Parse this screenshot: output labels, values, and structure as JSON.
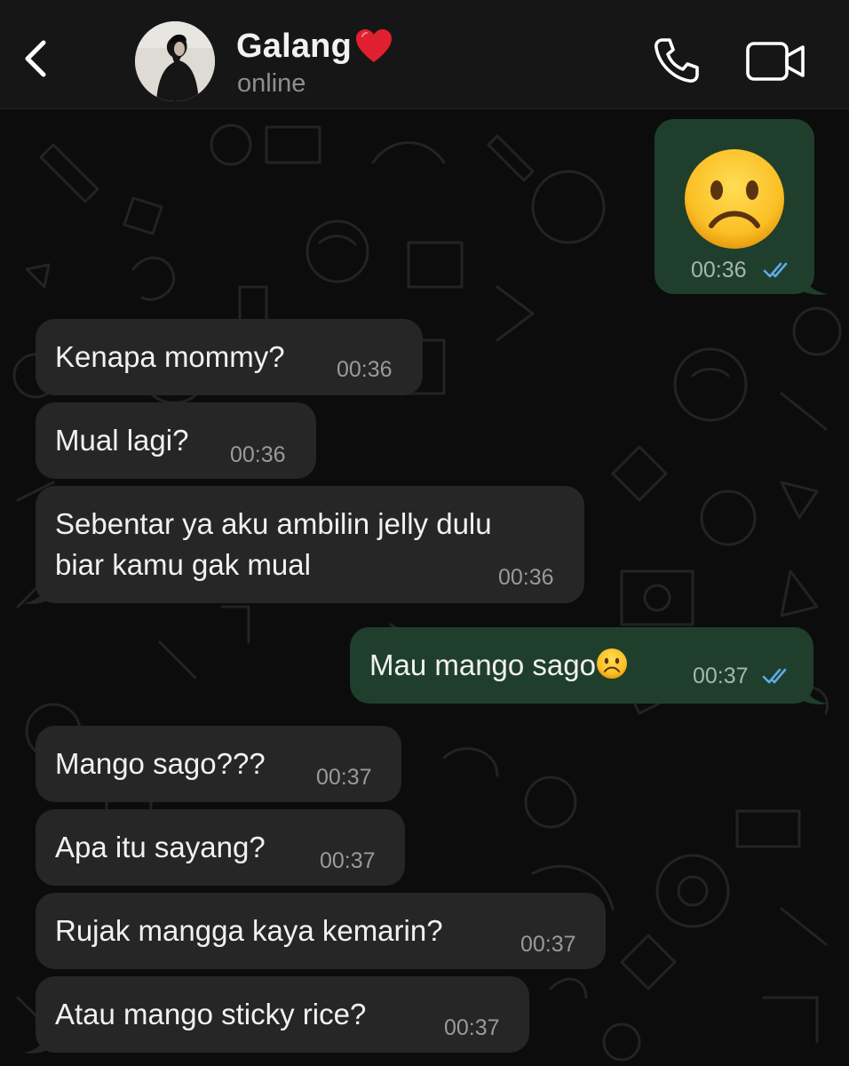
{
  "header": {
    "contact_name": "Galang",
    "status": "online",
    "icons": {
      "back": "chevron-left-icon",
      "heart": "red-heart-emoji",
      "call": "phone-icon",
      "video": "video-camera-icon"
    }
  },
  "messages": [
    {
      "direction": "out",
      "text": "",
      "emoji": "frowning-face",
      "time": "00:36",
      "read": true
    },
    {
      "direction": "in",
      "text": "Kenapa mommy?",
      "time": "00:36"
    },
    {
      "direction": "in",
      "text": "Mual lagi?",
      "time": "00:36"
    },
    {
      "direction": "in",
      "lines": [
        "Sebentar ya aku ambilin jelly dulu",
        "biar kamu gak mual"
      ],
      "time": "00:36"
    },
    {
      "direction": "out",
      "text": "Mau mango sago",
      "emoji": "frowning-face",
      "time": "00:37",
      "read": true
    },
    {
      "direction": "in",
      "text": "Mango sago???",
      "time": "00:37"
    },
    {
      "direction": "in",
      "text": "Apa itu sayang?",
      "time": "00:37"
    },
    {
      "direction": "in",
      "text": "Rujak mangga kaya kemarin?",
      "time": "00:37"
    },
    {
      "direction": "in",
      "text": "Atau mango sticky rice?",
      "time": "00:37"
    }
  ],
  "colors": {
    "header_bg": "#161616",
    "incoming_bubble": "#262626",
    "outgoing_bubble": "#1f3f2c",
    "read_ticks": "#5fa9e8",
    "wallpaper": "#0c0c0c"
  }
}
